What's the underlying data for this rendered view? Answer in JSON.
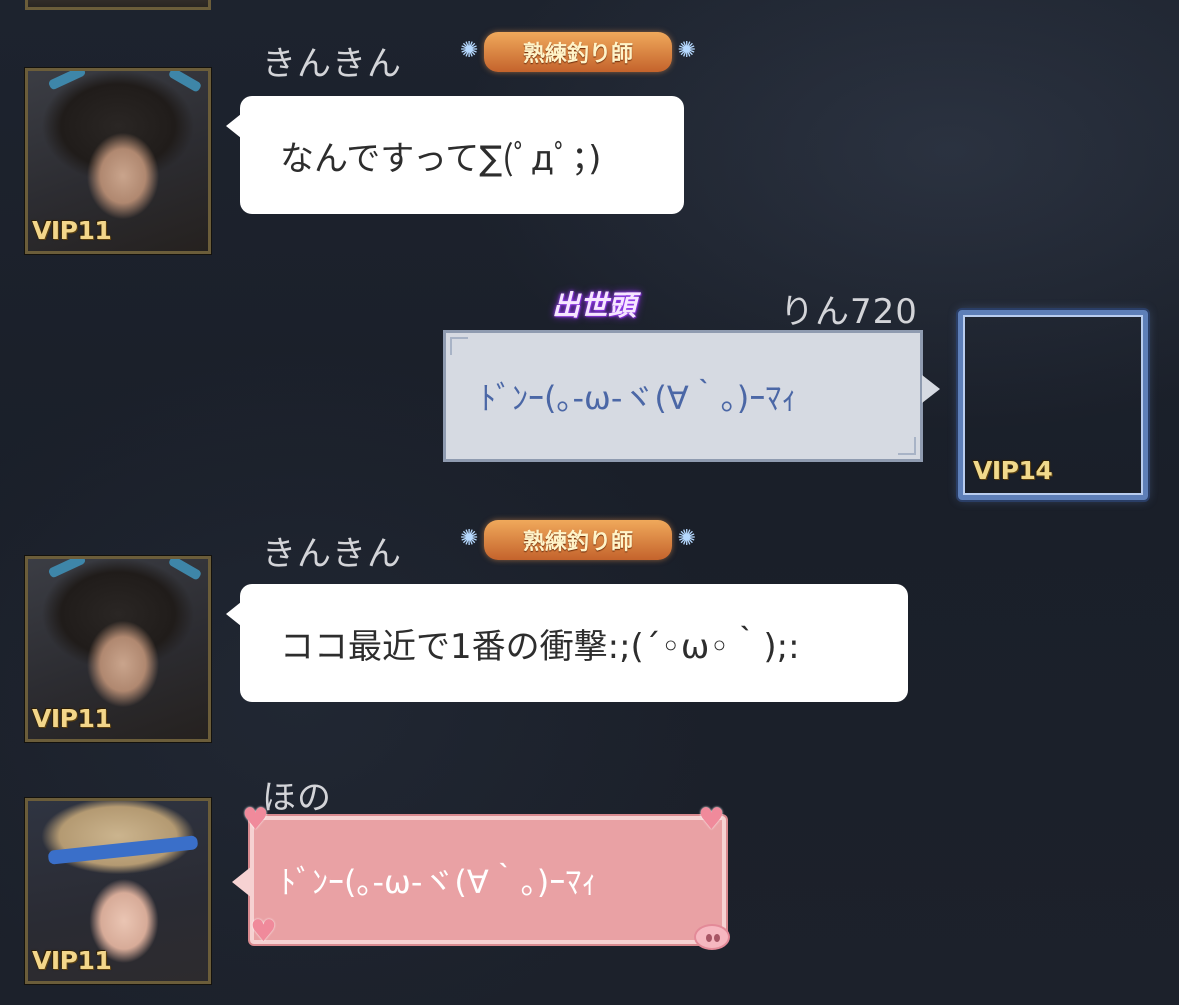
{
  "messages": [
    {
      "username": "きんきん",
      "title": "熟練釣り師",
      "text": "なんですって∑(ﾟдﾟ；)",
      "vip": "VIP11"
    },
    {
      "username": "りん720",
      "title": "出世頭",
      "text": "ﾄﾞﾝｰ(｡-ω-ヾ(∀｀｡)ｰﾏｨ",
      "vip": "VIP14"
    },
    {
      "username": "きんきん",
      "title": "熟練釣り師",
      "text": "ココ最近で1番の衝撃:;(´◦ω◦｀);:",
      "vip": "VIP11"
    },
    {
      "username": "ほの",
      "text": "ﾄﾞﾝｰ(｡-ω-ヾ(∀｀｡)ｰﾏｨ",
      "vip": "VIP11"
    }
  ],
  "colors": {
    "background": "#1b212b",
    "bubble_white": "#ffffff",
    "bubble_gray": "#d6dae2",
    "bubble_pink": "#e9a1a4",
    "text_blue": "#4b67a6",
    "username": "#d3d4d8"
  }
}
